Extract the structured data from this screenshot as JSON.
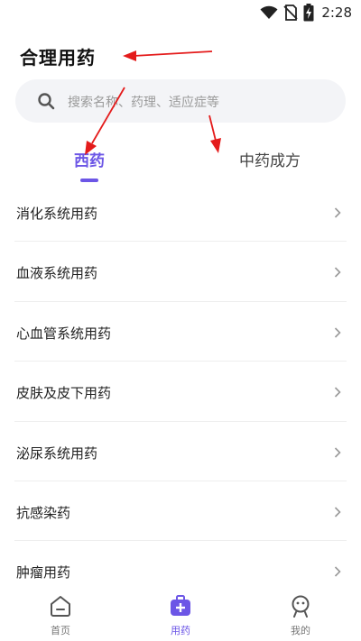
{
  "status": {
    "time": "2:28"
  },
  "page": {
    "title": "合理用药"
  },
  "search": {
    "placeholder": "搜索名称、药理、适应症等"
  },
  "tabs": [
    {
      "label": "西药",
      "active": true
    },
    {
      "label": "中药成方",
      "active": false
    }
  ],
  "categories": [
    {
      "label": "消化系统用药"
    },
    {
      "label": "血液系统用药"
    },
    {
      "label": "心血管系统用药"
    },
    {
      "label": "皮肤及皮下用药"
    },
    {
      "label": "泌尿系统用药"
    },
    {
      "label": "抗感染药"
    },
    {
      "label": "肿瘤用药"
    }
  ],
  "nav": {
    "home": "首页",
    "medicine": "用药",
    "mine": "我的"
  },
  "colors": {
    "accent": "#6c56e6",
    "annotation_arrow": "#e41b1b"
  },
  "icons": [
    "wifi-icon",
    "no-sim-icon",
    "battery-charging-icon",
    "search-icon",
    "chevron-right-icon",
    "home-icon",
    "medicine-box-icon",
    "profile-icon"
  ]
}
